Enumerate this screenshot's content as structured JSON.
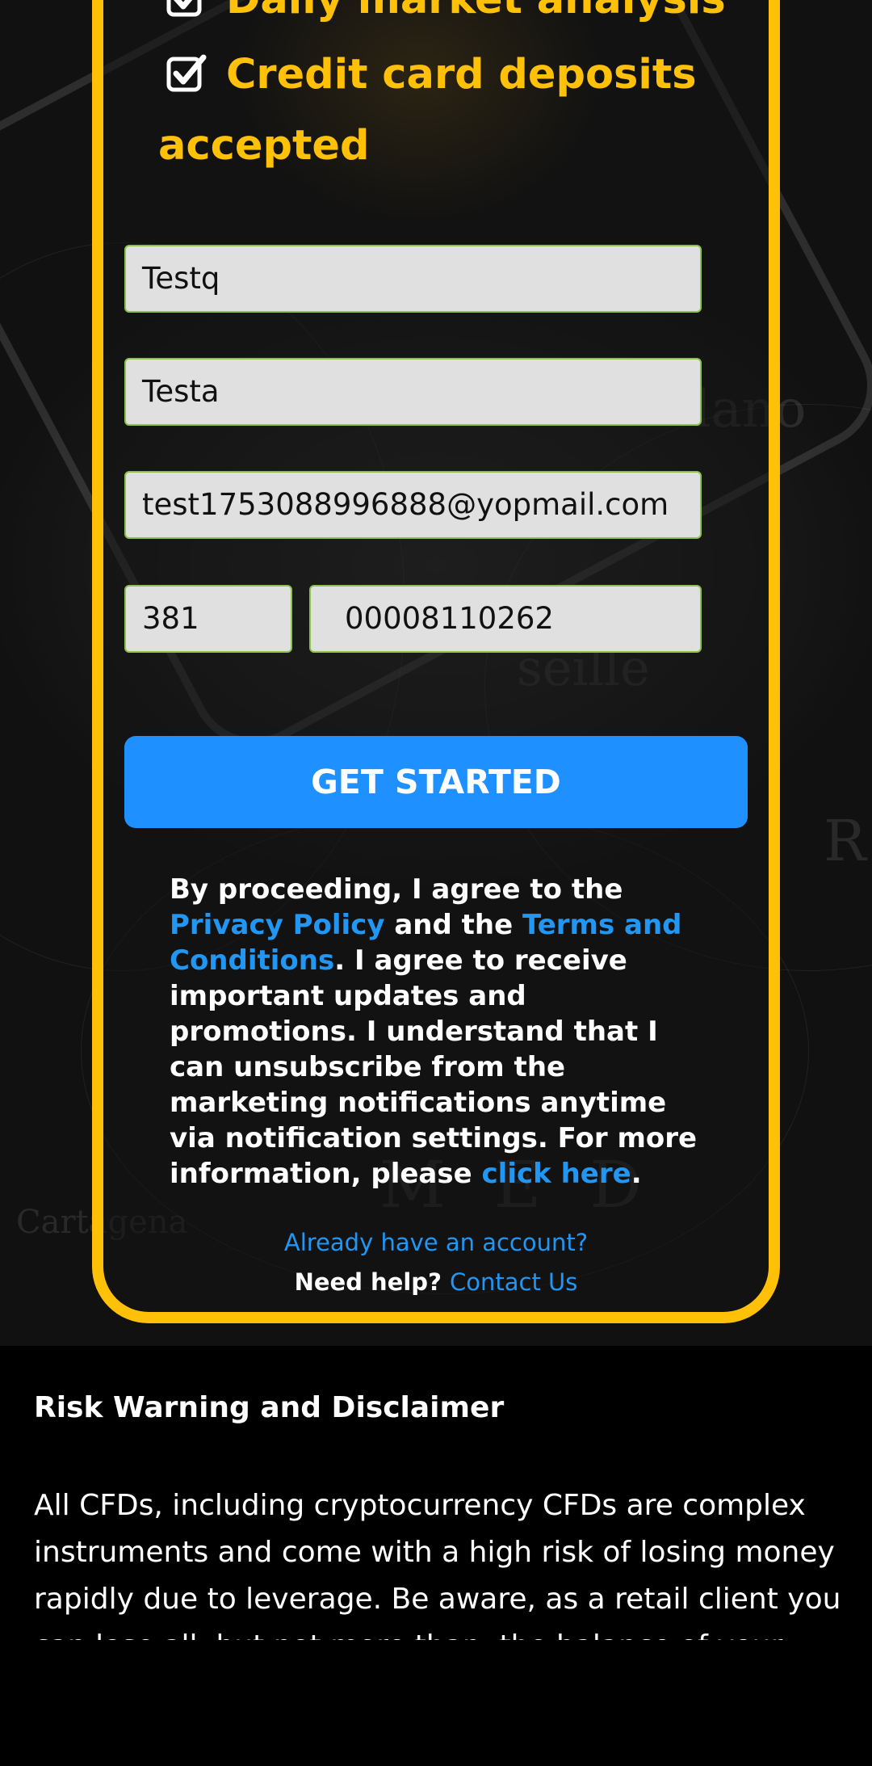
{
  "features": [
    {
      "icon": "checkbox-icon",
      "label": "Daily market analysis"
    },
    {
      "icon": "checkbox-icon",
      "label": "Credit card deposits accepted"
    }
  ],
  "form": {
    "first_name": {
      "value": "Testq"
    },
    "last_name": {
      "value": "Testa"
    },
    "email": {
      "value": "test1753088996888@yopmail.com"
    },
    "phone_prefix": {
      "value": "381"
    },
    "phone_number": {
      "value": "00008110262"
    },
    "submit_label": "GET STARTED"
  },
  "consent": {
    "part1": "By proceeding, I agree to the ",
    "privacy_link": "Privacy Policy",
    "part2": " and the ",
    "terms_link": "Terms and Conditions",
    "part3": ". I agree to receive important updates and promotions. I understand that I can unsubscribe from the marketing notifications anytime via notification settings. For more information, please ",
    "click_link": "click here",
    "part4": "."
  },
  "account": {
    "login_link": "Already have an account?",
    "help_text": "Need help?",
    "contact_link": "Contact Us"
  },
  "risk": {
    "title": "Risk Warning and Disclaimer",
    "body": "All CFDs, including cryptocurrency CFDs are complex instruments and come with a high risk of losing money rapidly due to leverage. Be aware, as a retail client you can lose all, but not more than, the balance of your account."
  },
  "colors": {
    "accent": "#ffc107",
    "button": "#1e90ff",
    "link": "#2196f3",
    "input_border": "#8bc34a"
  }
}
